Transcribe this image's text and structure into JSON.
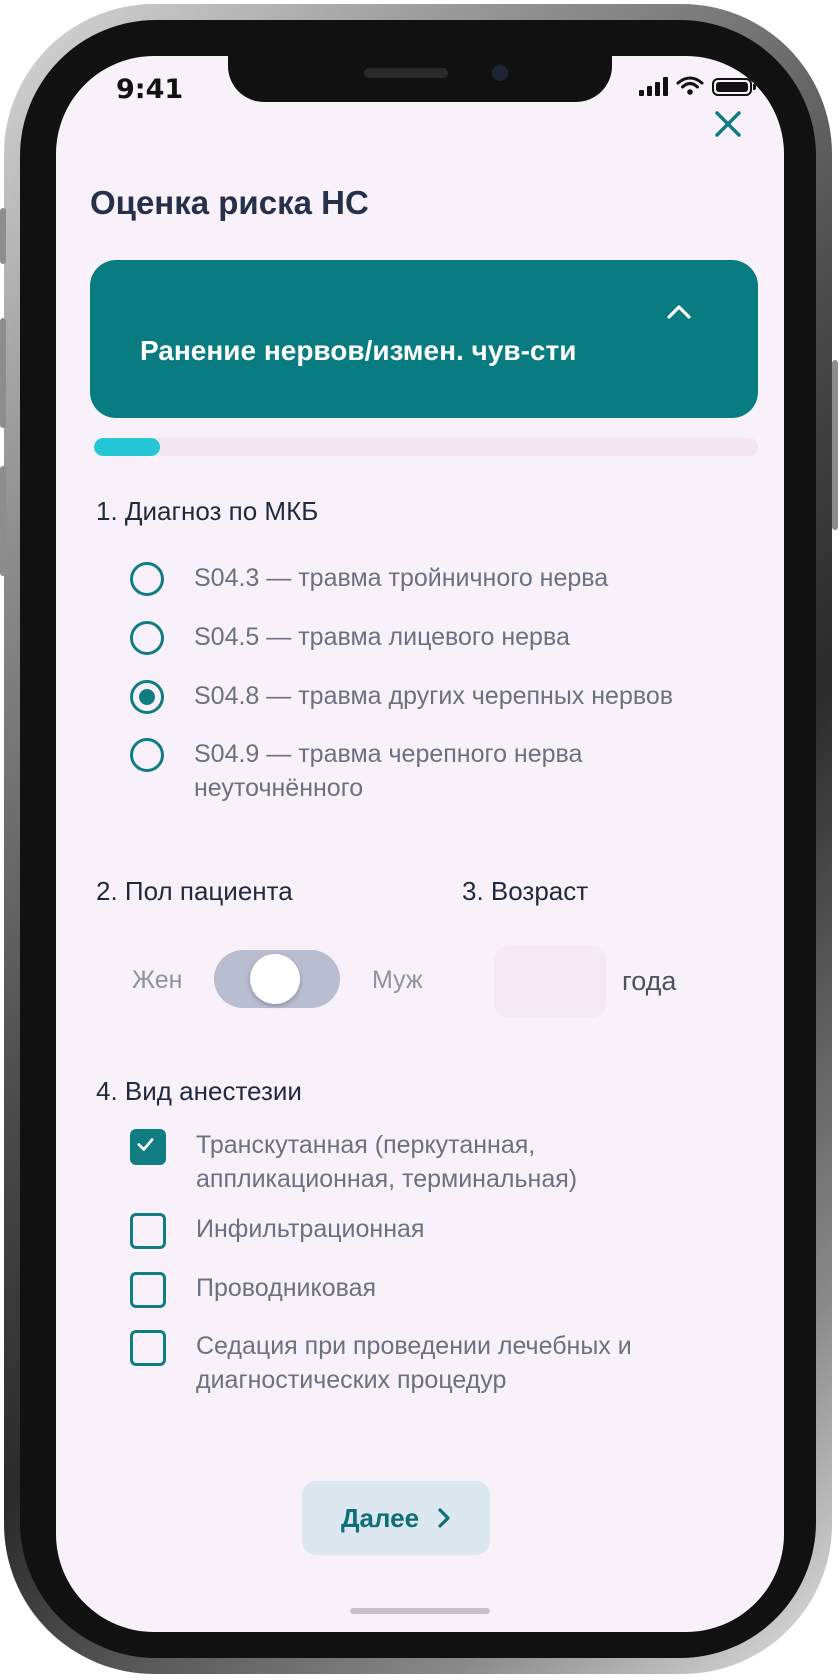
{
  "status_bar": {
    "time": "9:41"
  },
  "header": {
    "title": "Оценка риска НС"
  },
  "section": {
    "label": "Ранение нервов/измен. чув-сти",
    "progress_fraction": 0.1
  },
  "diagnosis": {
    "label": "1. Диагноз по МКБ",
    "options": [
      {
        "line1": "S04.3 — травма тройничного нерва",
        "line2": "",
        "checked": false
      },
      {
        "line1": "S04.5 — травма лицевого нерва",
        "line2": "",
        "checked": false
      },
      {
        "line1": "S04.8 — травма других черепных нервов",
        "line2": "",
        "checked": true
      },
      {
        "line1": "S04.9 — травма черепного нерва",
        "line2": "неуточнённого",
        "checked": false
      }
    ]
  },
  "sex": {
    "label": "2. Пол пациента",
    "left_label": "Жен",
    "right_label": "Муж"
  },
  "age": {
    "label": "3. Возраст",
    "value": "",
    "unit": "года"
  },
  "anesthesia": {
    "label": "4. Вид анестезии",
    "options": [
      {
        "line1": "Транскутанная (перкутанная,",
        "line2": "аппликационная, терминальная)",
        "checked": true
      },
      {
        "line1": "Инфильтрационная",
        "line2": "",
        "checked": false
      },
      {
        "line1": "Проводниковая",
        "line2": "",
        "checked": false
      },
      {
        "line1": "Седация при проведении лечебных и",
        "line2": "диагностических процедур",
        "checked": false
      }
    ]
  },
  "footer": {
    "next_label": "Далее"
  },
  "colors": {
    "accent": "#087c80",
    "progress": "#25c6d6",
    "background": "#f9f1fa"
  },
  "icons": [
    "close-icon",
    "chevron-up-icon",
    "chevron-right-icon",
    "check-icon",
    "signal-icon",
    "wifi-icon",
    "battery-icon"
  ]
}
